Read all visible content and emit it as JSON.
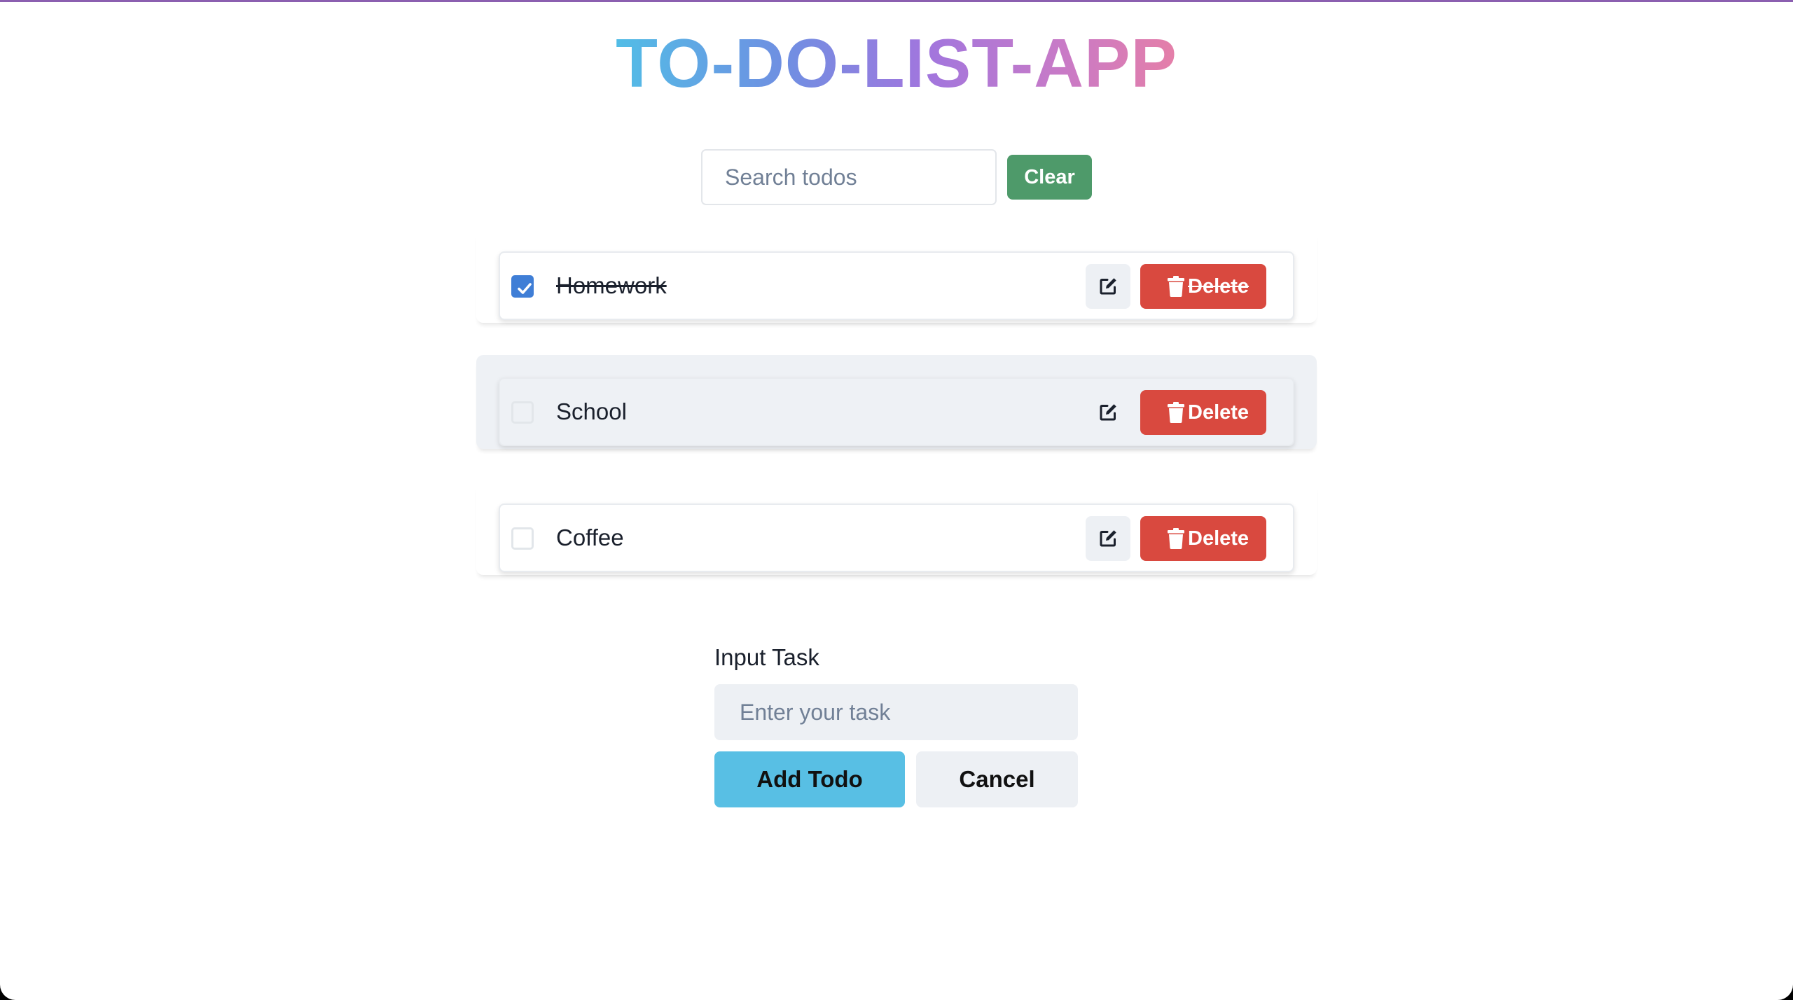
{
  "app": {
    "title": "TO-DO-LIST-APP"
  },
  "search": {
    "placeholder": "Search todos",
    "value": "",
    "clear_label": "Clear"
  },
  "todos": [
    {
      "text": "Homework",
      "completed": true,
      "delete_label": "Delete"
    },
    {
      "text": "School",
      "completed": false,
      "delete_label": "Delete"
    },
    {
      "text": "Coffee",
      "completed": false,
      "delete_label": "Delete"
    }
  ],
  "form": {
    "label": "Input Task",
    "placeholder": "Enter your task",
    "value": "",
    "add_label": "Add Todo",
    "cancel_label": "Cancel"
  },
  "icons": {
    "edit": "edit-icon",
    "delete": "trash-icon",
    "check": "checkmark-icon"
  },
  "colors": {
    "title_gradient": [
      "#52bde6",
      "#a176de",
      "#e57fa8"
    ],
    "clear_button": "#4e9a6a",
    "delete_button": "#d9493f",
    "add_button": "#58bfe4",
    "checkbox_checked": "#3f7ed6"
  }
}
